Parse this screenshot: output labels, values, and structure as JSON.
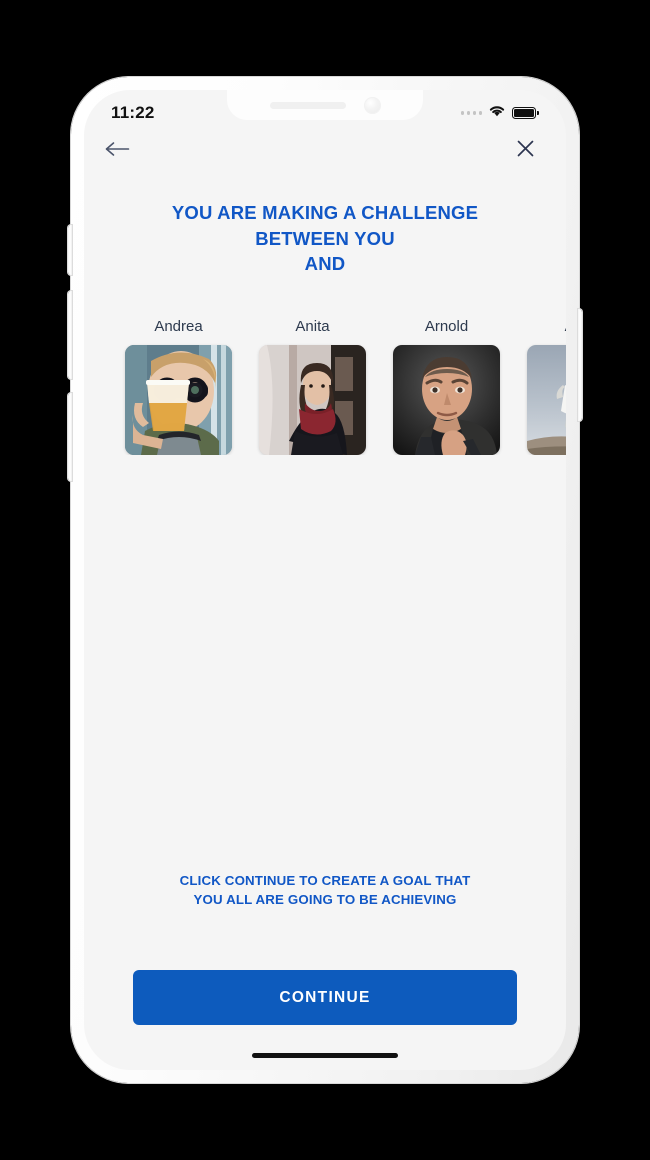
{
  "status_bar": {
    "time": "11:22",
    "signal_dots": 4,
    "wifi_icon": "wifi-icon",
    "battery_icon": "battery-icon",
    "battery_level_percent": 100
  },
  "nav_bar": {
    "back_icon": "arrow-left-icon",
    "close_icon": "close-icon"
  },
  "headline": {
    "lines": [
      "YOU ARE MAKING A CHALLENGE",
      "BETWEEN YOU",
      "AND"
    ]
  },
  "contacts": [
    {
      "name": "Andrea",
      "photo": "andrea-drinking-beer-photo"
    },
    {
      "name": "Anita",
      "photo": "anita-red-scarf-photo"
    },
    {
      "name": "Arnold",
      "photo": "arnold-portrait-photo"
    },
    {
      "name": "Audr",
      "photo": "audrey-hiking-photo"
    }
  ],
  "footer": {
    "note_lines": [
      "CLICK CONTINUE TO CREATE A GOAL THAT",
      "YOU ALL ARE GOING TO BE ACHIEVING"
    ],
    "continue_label": "CONTINUE"
  },
  "colors": {
    "accent_blue": "#1157c6",
    "button_blue": "#0d5bbd",
    "screen_background": "#f5f5f5",
    "name_text": "#2d3a4e"
  }
}
